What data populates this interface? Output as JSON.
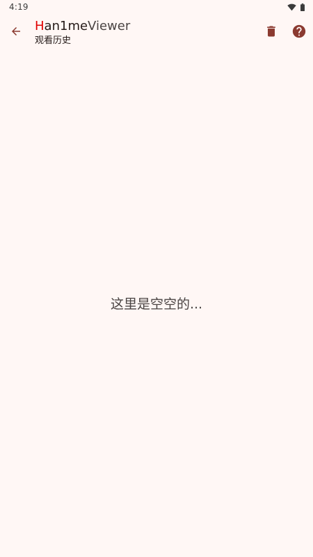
{
  "status_bar": {
    "time": "4:19",
    "wifi_icon": "wifi-icon",
    "battery_icon": "battery-icon"
  },
  "app_bar": {
    "title_part_1": "H",
    "title_part_2": "an1me",
    "title_part_3": "Viewer",
    "subtitle": "观看历史",
    "back_icon": "arrow-back-icon",
    "delete_icon": "trash-icon",
    "help_icon": "help-circle-icon"
  },
  "main": {
    "empty_message": "这里是空空的..."
  },
  "colors": {
    "background": "#FFF7F5",
    "icon_tint": "#8B3A30",
    "title_accent": "#E00000",
    "text_primary": "#231917",
    "text_secondary": "#4A4443"
  }
}
